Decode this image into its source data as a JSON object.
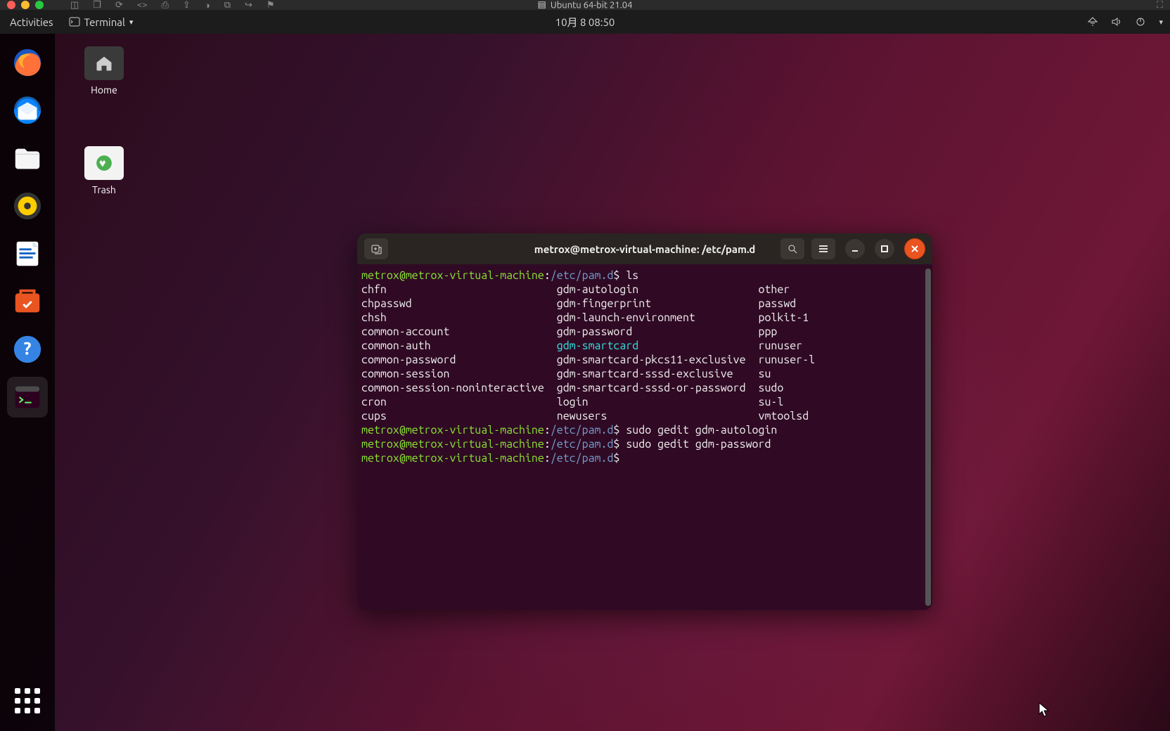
{
  "host": {
    "vm_label": "Ubuntu 64-bit 21.04"
  },
  "gnome": {
    "activities": "Activities",
    "app_name": "Terminal",
    "clock": "10月 8  08:50"
  },
  "desktop_icons": {
    "home": "Home",
    "trash": "Trash"
  },
  "dock": {
    "items": [
      "firefox",
      "thunderbird",
      "files",
      "rhythmbox",
      "writer",
      "software",
      "help",
      "terminal"
    ]
  },
  "terminal": {
    "title": "metrox@metrox-virtual-machine: /etc/pam.d",
    "prompt_user": "metrox@metrox-virtual-machine",
    "prompt_sep": ":",
    "prompt_path": "/etc/pam.d",
    "prompt_sym": "$",
    "cmds": {
      "c1": "ls",
      "c2": "sudo gedit gdm-autologin",
      "c3": "sudo gedit gdm-password"
    },
    "ls": {
      "col1": [
        "chfn",
        "chpasswd",
        "chsh",
        "common-account",
        "common-auth",
        "common-password",
        "common-session",
        "common-session-noninteractive",
        "cron",
        "cups"
      ],
      "col2": [
        "gdm-autologin",
        "gdm-fingerprint",
        "gdm-launch-environment",
        "gdm-password",
        "gdm-smartcard",
        "gdm-smartcard-pkcs11-exclusive",
        "gdm-smartcard-sssd-exclusive",
        "gdm-smartcard-sssd-or-password",
        "login",
        "newusers"
      ],
      "col3": [
        "other",
        "passwd",
        "polkit-1",
        "ppp",
        "runuser",
        "runuser-l",
        "su",
        "sudo",
        "su-l",
        "vmtoolsd"
      ]
    }
  }
}
